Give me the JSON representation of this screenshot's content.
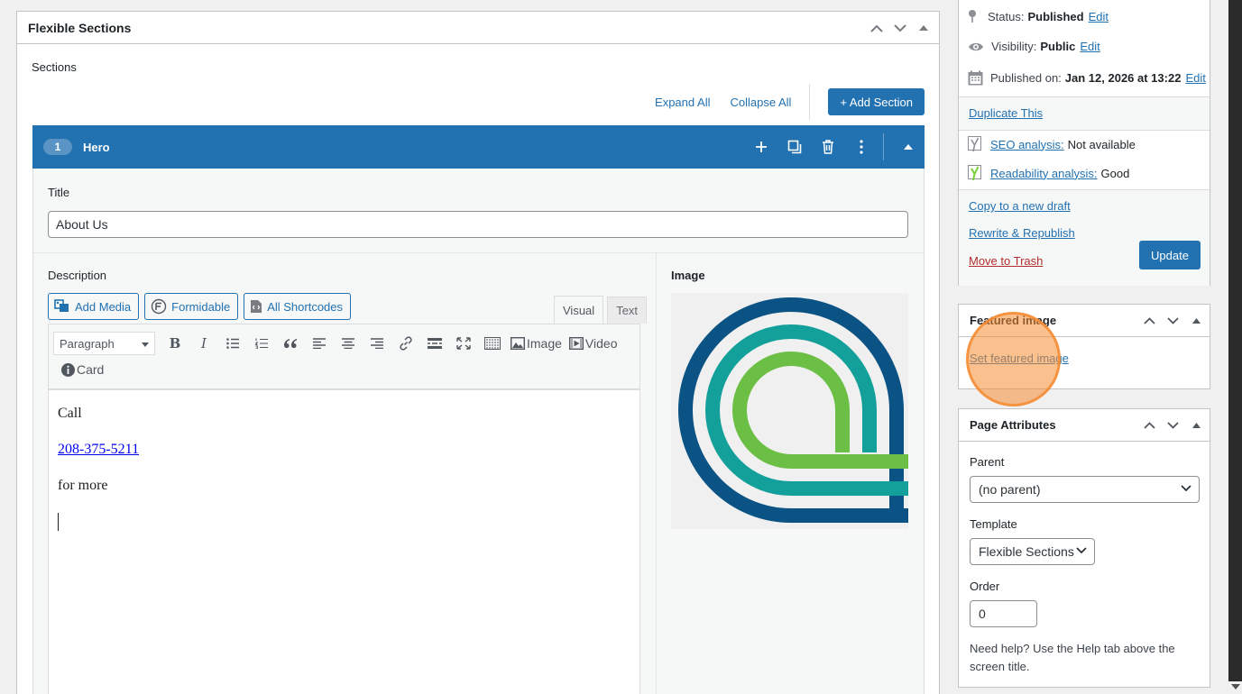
{
  "metabox": {
    "title": "Flexible Sections",
    "sections_label": "Sections",
    "expand_all": "Expand All",
    "collapse_all": "Collapse All",
    "add_section": "+ Add Section"
  },
  "hero": {
    "number": "1",
    "name": "Hero",
    "title_label": "Title",
    "title_value": "About Us",
    "description_label": "Description",
    "add_media": "Add Media",
    "formidable": "Formidable",
    "all_shortcodes": "All Shortcodes",
    "tab_visual": "Visual",
    "tab_text": "Text",
    "format_select": "Paragraph",
    "tool_image": "Image",
    "tool_video": "Video",
    "tool_card": "Card",
    "content": {
      "line1": "Call",
      "phone": "208-375-5211",
      "line3": "for more"
    },
    "image_label": "Image",
    "logo_colors": [
      "#0b5384",
      "#13a09a",
      "#6cbf45"
    ]
  },
  "publish": {
    "status_label": "Status:",
    "status_value": "Published",
    "visibility_label": "Visibility:",
    "visibility_value": "Public",
    "published_label": "Published on:",
    "published_value": "Jan 12, 2026 at 13:22",
    "edit": "Edit",
    "duplicate": "Duplicate This",
    "seo_label": "SEO analysis:",
    "seo_value": "Not available",
    "readability_label": "Readability analysis:",
    "readability_value": "Good",
    "copy_draft": "Copy to a new draft",
    "rewrite": "Rewrite & Republish",
    "trash": "Move to Trash",
    "update": "Update"
  },
  "featured_image": {
    "title": "Featured image",
    "set_link": "Set featured image"
  },
  "page_attributes": {
    "title": "Page Attributes",
    "parent_label": "Parent",
    "parent_value": "(no parent)",
    "template_label": "Template",
    "template_value": "Flexible Sections",
    "order_label": "Order",
    "order_value": "0",
    "help": "Need help? Use the Help tab above the screen title."
  },
  "colors": {
    "primary": "#2271b1",
    "trash": "#b32d2e",
    "yoast_good": "#7ad03a",
    "click_marker": "#f58c32"
  }
}
